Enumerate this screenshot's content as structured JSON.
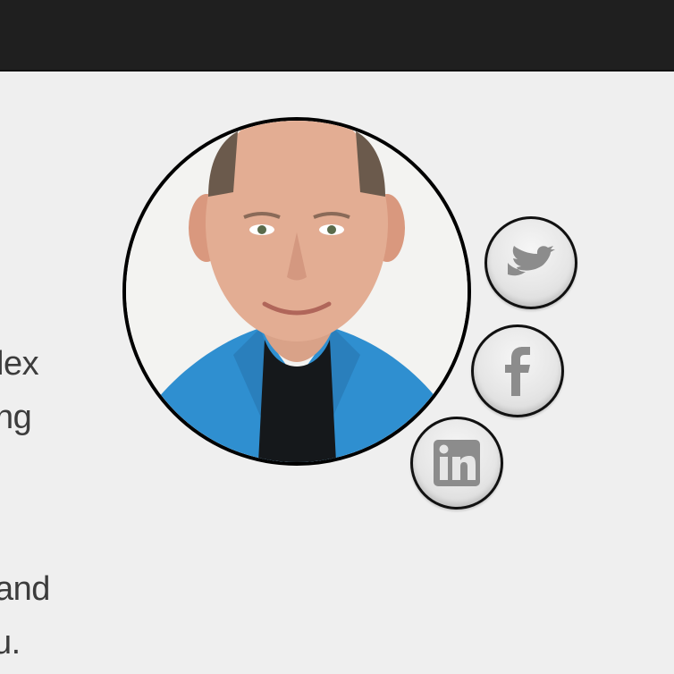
{
  "content": {
    "text_fragments": [
      "lex",
      "ng",
      "and",
      "u."
    ]
  },
  "profile": {
    "avatar_icon": "profile-photo"
  },
  "social": {
    "twitter_icon": "twitter-icon",
    "facebook_icon": "facebook-icon",
    "linkedin_icon": "linkedin-icon",
    "button_color": "#e8e8e8",
    "icon_color": "#8c8c8c"
  },
  "colors": {
    "top_bar": "#1f1f1f",
    "background": "#efefef"
  }
}
